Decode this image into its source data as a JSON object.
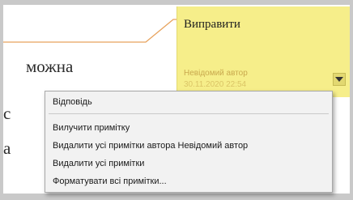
{
  "document": {
    "word": "можна",
    "cut_text_1": "с",
    "cut_text_2": "а"
  },
  "comment": {
    "text": "Виправити",
    "author": "Невідомий автор",
    "date": "30.11.2020 22:54",
    "menu_button_icon": "chevron-down-icon",
    "background_color": "#f6ee8a",
    "connector_color": "#e7a25c"
  },
  "context_menu": {
    "reply": "Відповідь",
    "items": [
      "Вилучити примітку",
      "Видалити усі примітки автора Невідомий автор",
      "Видалити усі примітки",
      "Форматувати всі примітки..."
    ]
  }
}
